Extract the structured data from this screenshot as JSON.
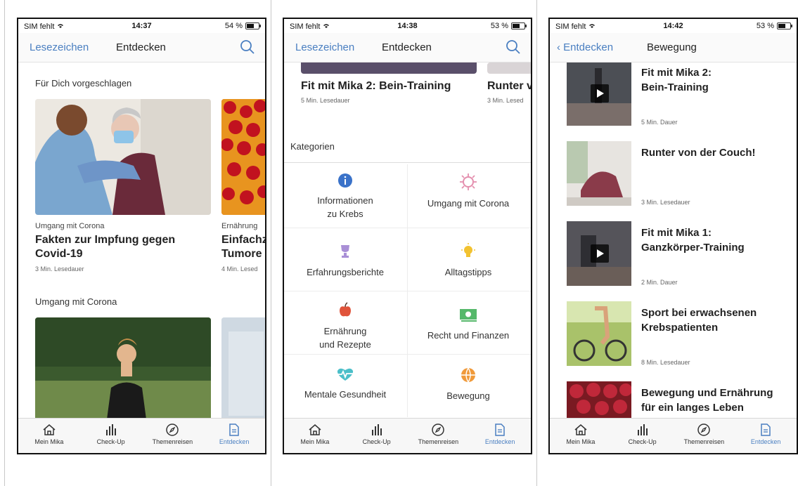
{
  "colors": {
    "accent": "#4a7fc1",
    "text": "#222222",
    "muted": "#666666"
  },
  "tabbar": [
    {
      "label": "Mein Mika",
      "icon": "home-icon"
    },
    {
      "label": "Check-Up",
      "icon": "bar-chart-icon"
    },
    {
      "label": "Themenreisen",
      "icon": "compass-icon"
    },
    {
      "label": "Entdecken",
      "icon": "document-icon"
    }
  ],
  "screen1": {
    "status": {
      "carrier": "SIM fehlt",
      "time": "14:37",
      "battery": "54 %",
      "battery_level": 0.54
    },
    "nav": {
      "left": "Lesezeichen",
      "title": "Entdecken"
    },
    "section1": "Für Dich vorgeschlagen",
    "cards": [
      {
        "category": "Umgang mit Corona",
        "title_line1": "Fakten zur Impfung gegen",
        "title_line2": "Covid-19",
        "meta": "3 Min. Lesedauer"
      },
      {
        "category": "Ernährung",
        "title_line1": "Einfachz",
        "title_line2": "Tumore",
        "meta": "4 Min. Lesed"
      }
    ],
    "section2": "Umgang mit Corona"
  },
  "screen2": {
    "status": {
      "carrier": "SIM fehlt",
      "time": "14:38",
      "battery": "53 %",
      "battery_level": 0.53
    },
    "nav": {
      "left": "Lesezeichen",
      "title": "Entdecken"
    },
    "top_cards": [
      {
        "title": "Fit mit Mika 2: Bein-Training",
        "meta": "5 Min. Lesedauer"
      },
      {
        "title": "Runter v",
        "meta": "3 Min. Lesed"
      }
    ],
    "categories_label": "Kategorien",
    "categories": [
      {
        "line1": "Informationen",
        "line2": "zu Krebs",
        "icon": "info-icon",
        "color": "#3a72c9"
      },
      {
        "line1": "Umgang mit Corona",
        "line2": "",
        "icon": "virus-icon",
        "color": "#e48fae"
      },
      {
        "line1": "Erfahrungsberichte",
        "line2": "",
        "icon": "trophy-icon",
        "color": "#a98fd6"
      },
      {
        "line1": "Alltagstipps",
        "line2": "",
        "icon": "lightbulb-icon",
        "color": "#f2c230"
      },
      {
        "line1": "Ernährung",
        "line2": "und Rezepte",
        "icon": "apple-icon",
        "color": "#e0533a"
      },
      {
        "line1": "Recht und Finanzen",
        "line2": "",
        "icon": "money-icon",
        "color": "#55b86a"
      },
      {
        "line1": "Mentale Gesundheit",
        "line2": "",
        "icon": "heartbeat-icon",
        "color": "#4bbfc9"
      },
      {
        "line1": "Bewegung",
        "line2": "",
        "icon": "ball-icon",
        "color": "#f09a3a"
      }
    ]
  },
  "screen3": {
    "status": {
      "carrier": "SIM fehlt",
      "time": "14:42",
      "battery": "53 %",
      "battery_level": 0.53
    },
    "nav": {
      "back": "Entdecken",
      "title": "Bewegung"
    },
    "items": [
      {
        "line1": "Fit mit Mika 2:",
        "line2": "Bein-Training",
        "meta": "5 Min. Dauer",
        "video": true
      },
      {
        "line1": "Runter von der Couch!",
        "line2": "",
        "meta": "3 Min. Lesedauer",
        "video": false
      },
      {
        "line1": "Fit mit Mika 1:",
        "line2": "Ganzkörper-Training",
        "meta": "2 Min. Dauer",
        "video": true
      },
      {
        "line1": "Sport bei erwachsenen",
        "line2": " Krebspatienten",
        "meta": "8 Min. Lesedauer",
        "video": false
      },
      {
        "line1": "Bewegung und Ernährung",
        "line2": "für ein langes Leben",
        "meta": "",
        "video": false
      }
    ]
  }
}
